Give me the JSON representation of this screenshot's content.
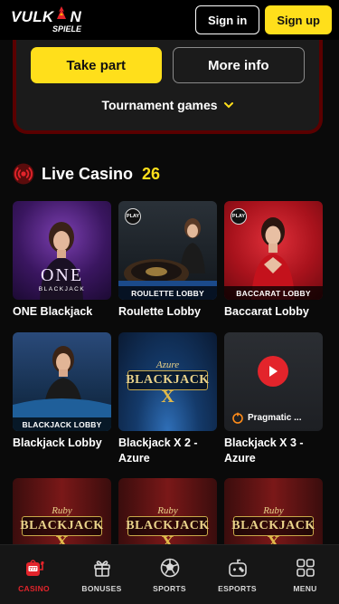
{
  "header": {
    "logo_main": "VULKAN",
    "logo_sub": "SPIELE",
    "signin_label": "Sign in",
    "signup_label": "Sign up"
  },
  "tournament": {
    "take_part_label": "Take part",
    "more_info_label": "More info",
    "games_label": "Tournament games"
  },
  "live_casino": {
    "title": "Live Casino",
    "count": "26"
  },
  "games": [
    {
      "name": "ONE Blackjack",
      "thumb_text": "ONE",
      "thumb_sub": "BLACKJACK",
      "icon": "one-blackjack-thumbnail"
    },
    {
      "name": "Roulette Lobby",
      "thumb_text": "ROULETTE LOBBY",
      "badge": "PLAY",
      "icon": "roulette-lobby-thumbnail"
    },
    {
      "name": "Baccarat Lobby",
      "thumb_text": "BACCARAT LOBBY",
      "badge": "PLAY",
      "icon": "baccarat-lobby-thumbnail"
    },
    {
      "name": "Blackjack Lobby",
      "thumb_text": "BLACKJACK LOBBY",
      "icon": "blackjack-lobby-thumbnail"
    },
    {
      "name": "Blackjack X 2 - Azure",
      "thumb_text": "BLACKJACK",
      "thumb_sub": "Azure",
      "thumb_x": "X",
      "icon": "blackjack-x2-azure-thumbnail"
    },
    {
      "name": "Blackjack X 3 - Azure",
      "thumb_text": "Pragmatic ...",
      "icon": "pragmatic-play-thumbnail"
    },
    {
      "name": "",
      "thumb_text": "BLACKJACK",
      "thumb_sub": "Ruby",
      "thumb_x": "X",
      "icon": "blackjack-ruby-thumbnail"
    },
    {
      "name": "",
      "thumb_text": "BLACKJACK",
      "thumb_sub": "Ruby",
      "thumb_x": "X",
      "icon": "blackjack-ruby-thumbnail"
    },
    {
      "name": "",
      "thumb_text": "BLACKJACK",
      "thumb_sub": "Ruby",
      "thumb_x": "X",
      "icon": "blackjack-ruby-thumbnail"
    }
  ],
  "bottom_nav": [
    {
      "label": "CASINO",
      "icon": "slot-machine-icon",
      "active": true
    },
    {
      "label": "BONUSES",
      "icon": "gift-icon"
    },
    {
      "label": "SPORTS",
      "icon": "soccer-ball-icon"
    },
    {
      "label": "ESPORTS",
      "icon": "gamepad-icon"
    },
    {
      "label": "MENU",
      "icon": "grid-menu-icon"
    }
  ],
  "colors": {
    "accent_yellow": "#ffdf1b",
    "accent_red": "#e3242b",
    "card_border": "#5a0000",
    "background": "#0a0a0a"
  }
}
